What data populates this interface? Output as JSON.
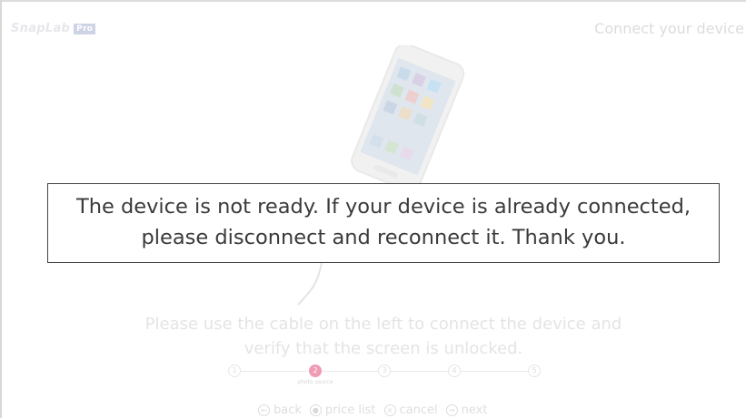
{
  "header": {
    "logo_text": "SnapLab",
    "logo_badge": "Pro",
    "title": "Connect your device"
  },
  "dialog": {
    "message_line1": "The device is not ready. If your device is already connected,",
    "message_line2": "please disconnect and reconnect it. Thank you."
  },
  "instructions": {
    "line1": "Please use the cable on the left to connect the device and",
    "line2": "verify that the screen is unlocked."
  },
  "stepper": {
    "current_step": 2,
    "steps": [
      {
        "number": "1"
      },
      {
        "number": "2",
        "caption": "photo source"
      },
      {
        "number": "3"
      },
      {
        "number": "4"
      },
      {
        "number": "5"
      }
    ]
  },
  "nav": {
    "back_label": "back",
    "price_list_label": "price list",
    "cancel_label": "cancel",
    "next_label": "next"
  },
  "colors": {
    "active_step": "#ef9bb3",
    "faded_text": "#e4e4e4",
    "message_text": "#3a3a3a"
  }
}
